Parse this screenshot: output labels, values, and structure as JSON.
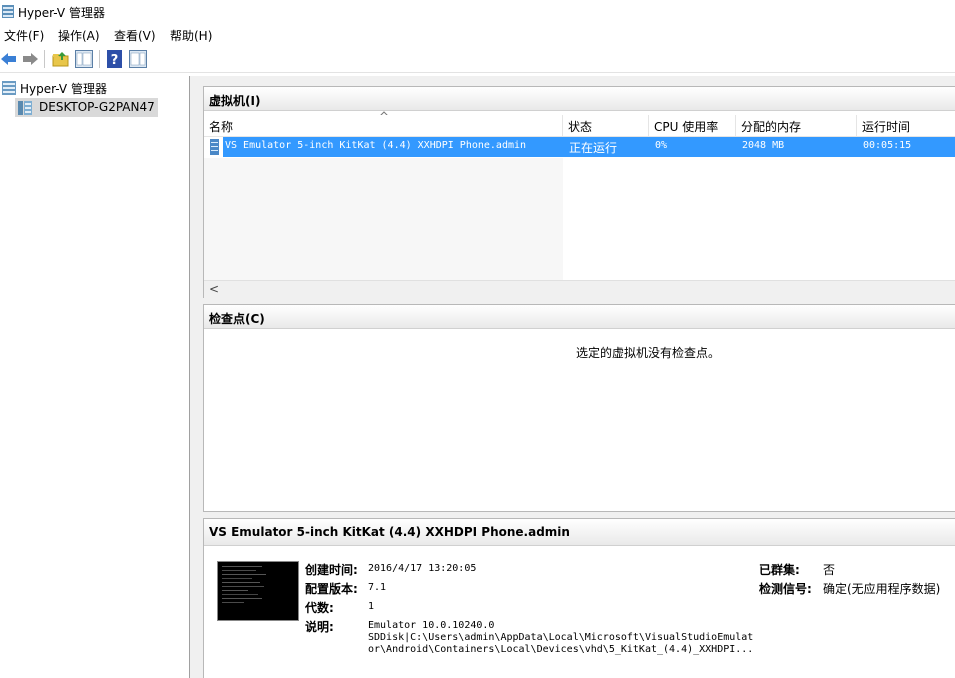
{
  "window": {
    "title": "Hyper-V 管理器"
  },
  "menu": [
    "文件(F)",
    "操作(A)",
    "查看(V)",
    "帮助(H)"
  ],
  "toolbar": {
    "buttons": [
      "back-arrow-icon",
      "forward-arrow-icon",
      "up-folder-icon",
      "show-hide-tree-icon",
      "help-icon",
      "action-pane-icon"
    ]
  },
  "tree": {
    "root": "Hyper-V 管理器",
    "server": "DESKTOP-G2PAN47"
  },
  "vms": {
    "title": "虚拟机(I)",
    "columns": [
      "名称",
      "状态",
      "CPU 使用率",
      "分配的内存",
      "运行时间"
    ],
    "rows": [
      {
        "name": "VS Emulator 5-inch KitKat (4.4) XXHDPI Phone.admin",
        "state": "正在运行",
        "cpu": "0%",
        "memory": "2048 MB",
        "uptime": "00:05:15"
      }
    ],
    "scroll_left": "<"
  },
  "checkpoints": {
    "title": "检查点(C)",
    "empty_message": "选定的虚拟机没有检查点。"
  },
  "details": {
    "title": "VS Emulator 5-inch KitKat (4.4) XXHDPI Phone.admin",
    "created_label": "创建时间:",
    "created_value": "2016/4/17 13:20:05",
    "config_label": "配置版本:",
    "config_value": "7.1",
    "generation_label": "代数:",
    "generation_value": "1",
    "notes_label": "说明:",
    "notes_line1": "Emulator 10.0.10240.0",
    "notes_line2": "SDDisk|C:\\Users\\admin\\AppData\\Local\\Microsoft\\VisualStudioEmulat",
    "notes_line3": "or\\Android\\Containers\\Local\\Devices\\vhd\\5_KitKat_(4.4)_XXHDPI...",
    "clustered_label": "已群集:",
    "clustered_value": "否",
    "heartbeat_label": "检测信号:",
    "heartbeat_value": "确定(无应用程序数据)"
  },
  "colors": {
    "selection": "#3399ff",
    "pane_border": "#b8b8b8"
  }
}
